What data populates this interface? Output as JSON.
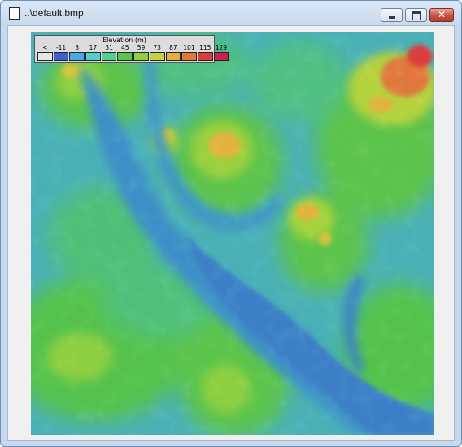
{
  "window": {
    "title": "..\\default.bmp",
    "close_glyph": "✕"
  },
  "legend": {
    "title": "Elevation (m)",
    "entries": [
      {
        "label": "<",
        "color": "#e6e6e6"
      },
      {
        "label": "-11",
        "color": "#3c5fd2"
      },
      {
        "label": "3",
        "color": "#47a9e8"
      },
      {
        "label": "17",
        "color": "#4fd0c8"
      },
      {
        "label": "31",
        "color": "#4ad48e"
      },
      {
        "label": "45",
        "color": "#58c64a"
      },
      {
        "label": "59",
        "color": "#92cf3c"
      },
      {
        "label": "73",
        "color": "#c8d23e"
      },
      {
        "label": "87",
        "color": "#e3b13d"
      },
      {
        "label": "101",
        "color": "#e0783c"
      },
      {
        "label": "115",
        "color": "#dc3c3c"
      },
      {
        "label": "129",
        "color": "#cc1e50"
      }
    ]
  }
}
